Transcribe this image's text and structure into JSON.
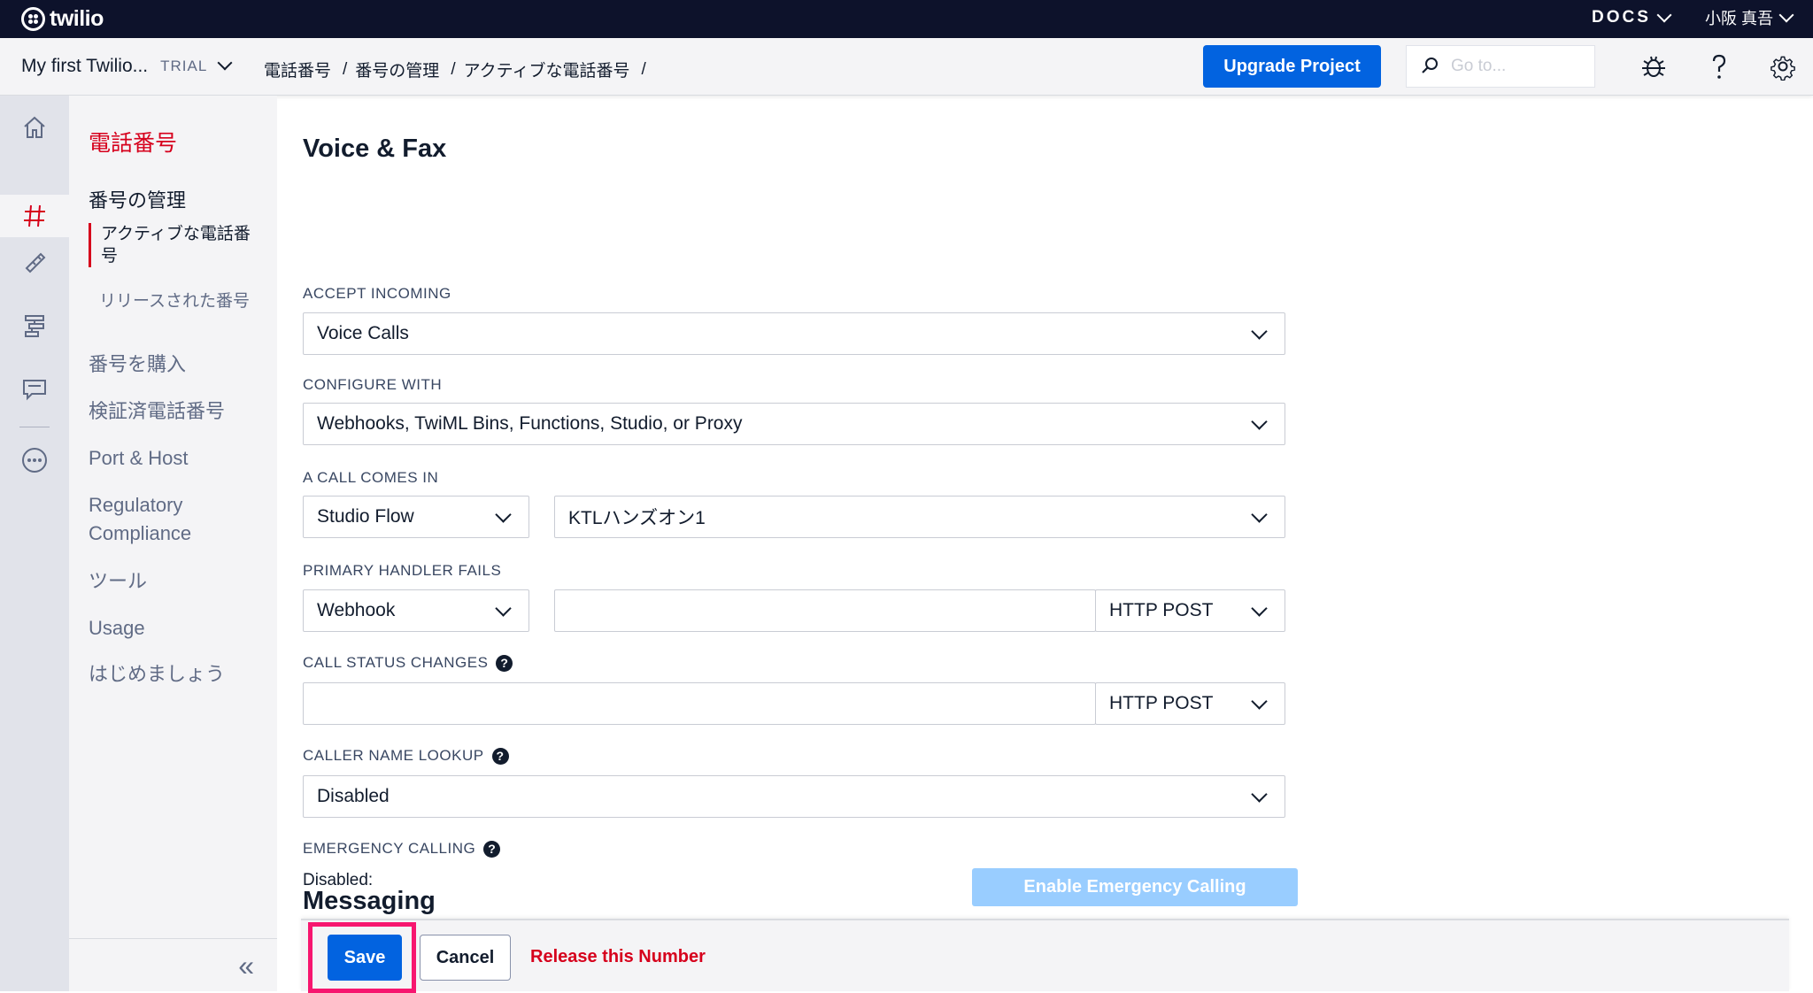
{
  "topbar": {
    "logo_text": "twilio",
    "docs_label": "DOCS",
    "user_name": "小阪 真吾"
  },
  "breadcrumb_bar": {
    "project_name": "My first Twilio...",
    "trial_label": "TRIAL",
    "crumbs": [
      "電話番号",
      "番号の管理",
      "アクティブな電話番号"
    ],
    "separator": "/",
    "upgrade_label": "Upgrade Project",
    "goto_placeholder": "Go to..."
  },
  "rail": {
    "icons": [
      "home-icon",
      "hash-icon",
      "phone-icon",
      "flow-icon",
      "chat-icon",
      "more-icon"
    ]
  },
  "sidebar": {
    "title": "電話番号",
    "section": "番号の管理",
    "sub_items": [
      "アクティブな電話番号",
      "リリースされた番号"
    ],
    "links": [
      "番号を購入",
      "検証済電話番号",
      "Port & Host",
      "Regulatory Compliance",
      "ツール",
      "Usage",
      "はじめましょう"
    ],
    "collapse_glyph": "«"
  },
  "form": {
    "section_title": "Voice & Fax",
    "accept_incoming": {
      "label": "ACCEPT INCOMING",
      "value": "Voice Calls"
    },
    "configure_with": {
      "label": "CONFIGURE WITH",
      "value": "Webhooks, TwiML Bins, Functions, Studio, or Proxy"
    },
    "call_comes_in": {
      "label": "A CALL COMES IN",
      "type_value": "Studio Flow",
      "flow_value": "KTLハンズオン1"
    },
    "primary_handler_fails": {
      "label": "PRIMARY HANDLER FAILS",
      "type_value": "Webhook",
      "url_value": "",
      "method_value": "HTTP POST"
    },
    "call_status_changes": {
      "label": "CALL STATUS CHANGES",
      "url_value": "",
      "method_value": "HTTP POST"
    },
    "caller_name_lookup": {
      "label": "CALLER NAME LOOKUP",
      "value": "Disabled"
    },
    "emergency_calling": {
      "label": "EMERGENCY CALLING",
      "status": "Disabled:",
      "button_label": "Enable Emergency Calling"
    },
    "help_glyph": "?",
    "next_section_title": "Messaging"
  },
  "actions": {
    "save_label": "Save",
    "cancel_label": "Cancel",
    "release_label": "Release this Number"
  },
  "colors": {
    "topbar_bg": "#0d122b",
    "primary_blue": "#0263e0",
    "brand_red": "#d6001c",
    "highlight_pink": "#f7166f",
    "disabled_blue": "#99cdff"
  }
}
